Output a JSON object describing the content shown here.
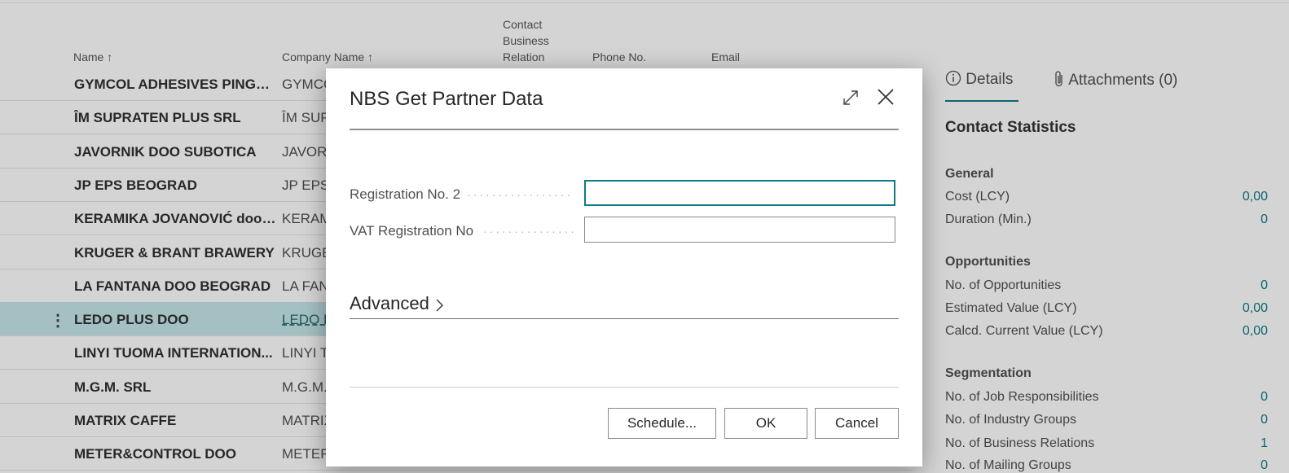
{
  "list": {
    "columns": {
      "name": "Name ↑",
      "company": "Company Name ↑",
      "relation_line1": "Contact",
      "relation_line2": "Business",
      "relation_line3": "Relation",
      "phone": "Phone No.",
      "email": "Email"
    },
    "rows": [
      {
        "name": "GYMCOL ADHESIVES PINGH...",
        "company": "GYMCO"
      },
      {
        "name": "ÎM SUPRATEN PLUS SRL",
        "company": "ÎM SUP"
      },
      {
        "name": "JAVORNIK DOO SUBOTICA",
        "company": "JAVOR"
      },
      {
        "name": "JP EPS BEOGRAD",
        "company": "JP EPS"
      },
      {
        "name": "KERAMIKA JOVANOVIĆ doo ...",
        "company": "KERAM"
      },
      {
        "name": "KRUGER & BRANT BRAWERY",
        "company": "KRUGE"
      },
      {
        "name": "LA FANTANA DOO BEOGRAD",
        "company": "LA FAN"
      },
      {
        "name": "LEDO PLUS DOO",
        "company": "LEDO P"
      },
      {
        "name": "LINYI TUOMA INTERNATION...",
        "company": "LINYI T"
      },
      {
        "name": "M.G.M. SRL",
        "company": "M.G.M."
      },
      {
        "name": "MATRIX CAFFE",
        "company": "MATRIX"
      },
      {
        "name": "METER&CONTROL DOO",
        "company": "METER"
      }
    ],
    "row_actions_icon": "vertical-ellipsis-icon"
  },
  "factbox": {
    "tabs": {
      "details": "Details",
      "attachments": "Attachments (0)"
    },
    "heading": "Contact Statistics",
    "general": {
      "title": "General",
      "cost_label": "Cost (LCY)",
      "cost_value": "0,00",
      "duration_label": "Duration (Min.)",
      "duration_value": "0"
    },
    "opportunities": {
      "title": "Opportunities",
      "count_label": "No. of Opportunities",
      "count_value": "0",
      "estimated_label": "Estimated Value (LCY)",
      "estimated_value": "0,00",
      "calcd_label": "Calcd. Current Value (LCY)",
      "calcd_value": "0,00"
    },
    "segmentation": {
      "title": "Segmentation",
      "job_label": "No. of Job Responsibilities",
      "job_value": "0",
      "industry_label": "No. of Industry Groups",
      "industry_value": "0",
      "business_label": "No. of Business Relations",
      "business_value": "1",
      "mailing_label": "No. of Mailing Groups",
      "mailing_value": "0"
    }
  },
  "dialog": {
    "title": "NBS Get Partner Data",
    "fields": {
      "reg2_label": "Registration No. 2",
      "reg2_value": "",
      "vat_label": "VAT Registration No",
      "vat_value": ""
    },
    "advanced_label": "Advanced",
    "buttons": {
      "schedule": "Schedule...",
      "ok": "OK",
      "cancel": "Cancel"
    }
  },
  "colors": {
    "accent": "#0f7b84",
    "selected_row": "#c7e7ea"
  }
}
